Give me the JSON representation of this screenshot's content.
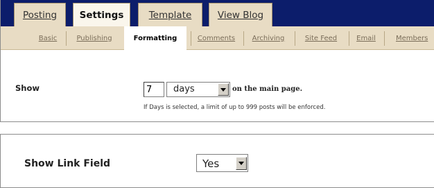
{
  "main_tabs": [
    {
      "label": "Posting",
      "active": false
    },
    {
      "label": "Settings",
      "active": true
    },
    {
      "label": "Template",
      "active": false
    },
    {
      "label": "View Blog",
      "active": false
    }
  ],
  "sub_tabs": [
    {
      "label": "Basic",
      "active": false
    },
    {
      "label": "Publishing",
      "active": false
    },
    {
      "label": "Formatting",
      "active": true
    },
    {
      "label": "Comments",
      "active": false
    },
    {
      "label": "Archiving",
      "active": false
    },
    {
      "label": "Site Feed",
      "active": false
    },
    {
      "label": "Email",
      "active": false
    },
    {
      "label": "Members",
      "active": false
    }
  ],
  "show_setting": {
    "label": "Show",
    "count_value": "7",
    "unit_value": "days",
    "suffix": "on the main page.",
    "hint": "If Days is selected, a limit of up to 999 posts will be enforced."
  },
  "link_field": {
    "label": "Show Link Field",
    "value": "Yes"
  },
  "colors": {
    "header_bar": "#0c1d6b",
    "tab_inactive": "#e8dcc4",
    "tab_active": "#faf6ec",
    "subtab_text": "#7a6d59"
  }
}
